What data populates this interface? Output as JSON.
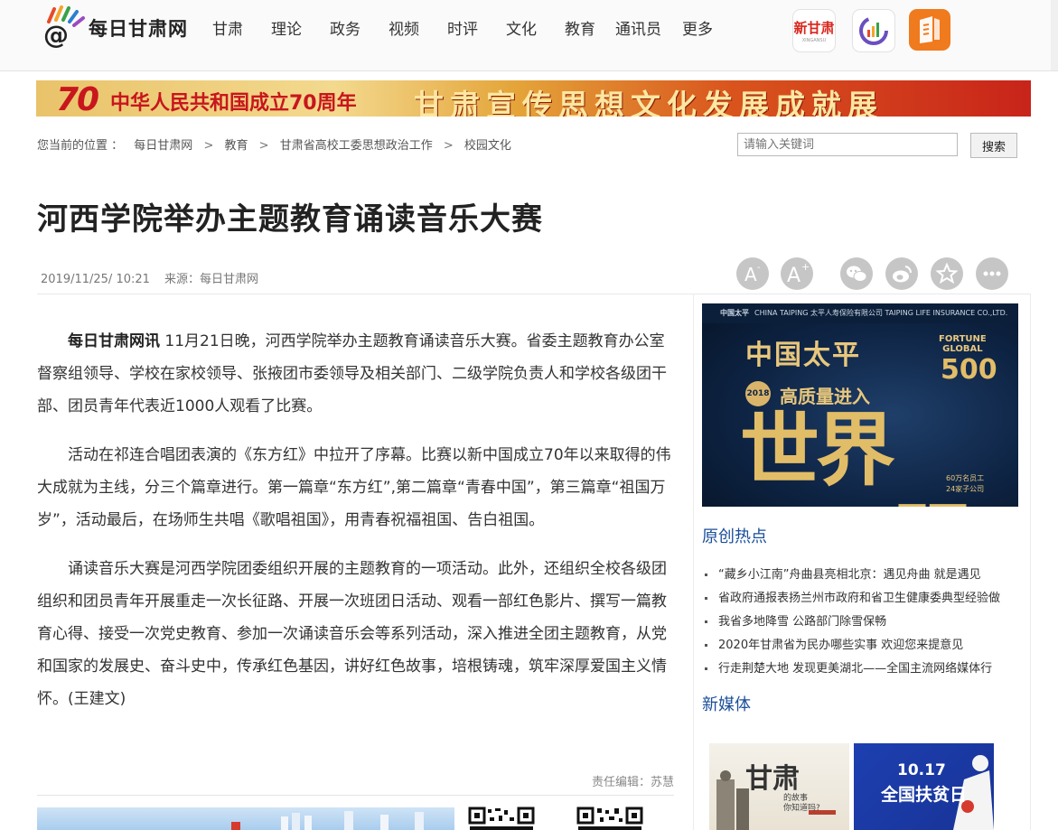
{
  "header": {
    "logo_text": "每日甘肃网",
    "nav": [
      "甘肃",
      "理论",
      "政务",
      "视频",
      "时评",
      "文化",
      "教育",
      "通讯员",
      "更多"
    ],
    "apps": [
      {
        "icon": "xingansu-app-icon",
        "label": "新甘肃",
        "sub": "XINGANSU",
        "color": "#d9251c"
      },
      {
        "icon": "chart-app-icon",
        "color": "#6a4fbf"
      },
      {
        "icon": "book-app-icon",
        "color": "#f07a1e"
      }
    ]
  },
  "banner": {
    "number": "70",
    "left_text": "中华人民共和国成立70周年",
    "right_text": "甘肃宣传思想文化发展成就展"
  },
  "breadcrumb": {
    "prefix": "您当前的位置 ：",
    "items": [
      "每日甘肃网",
      "教育",
      "甘肃省高校工委思想政治工作",
      "校园文化"
    ],
    "separator": ">"
  },
  "search": {
    "placeholder": "请输入关键词",
    "button": "搜索"
  },
  "article": {
    "title": "河西学院举办主题教育诵读音乐大赛",
    "date": "2019/11/25/ 10:21",
    "source": "来源：每日甘肃网",
    "lead": "每日甘肃网讯",
    "p1": " 11月21日晚，河西学院举办主题教育诵读音乐大赛。省委主题教育办公室督察组领导、学校在家校领导、张掖团市委领导及相关部门、二级学院负责人和学校各级团干部、团员青年代表近1000人观看了比赛。",
    "p2": "活动在祁连合唱团表演的《东方红》中拉开了序幕。比赛以新中国成立70年以来取得的伟大成就为主线，分三个篇章进行。第一篇章“东方红”,第二篇章“青春中国”，第三篇章“祖国万岁”，活动最后，在场师生共唱《歌唱祖国》，用青春祝福祖国、告白祖国。",
    "p3": "诵读音乐大赛是河西学院团委组织开展的主题教育的一项活动。此外，还组织全校各级团组织和团员青年开展重走一次长征路、开展一次班团日活动、观看一部红色影片、撰写一篇教育心得、接受一次党史教育、参加一次诵读音乐会等系列活动，深入推进全团主题教育，从党和国家的发展史、奋斗史中，传承红色基因，讲好红色故事，培根铸魂，筑牢深厚爱国主义情怀。(王建文)",
    "editor": "责任编辑：苏慧"
  },
  "tools": [
    "font-smaller-icon",
    "font-larger-icon",
    "wechat-icon",
    "weibo-icon",
    "favorite-icon",
    "more-icon"
  ],
  "ad": {
    "top_cn": "中国太平",
    "top_line": "CHINA TAIPING  太平人寿保险有限公司  TAIPING LIFE INSURANCE CO.,LTD.",
    "brand": "中国太平",
    "year": "2018",
    "mid": "高质量进入",
    "big": "世界500强",
    "fortune": "FORTUNE",
    "global": "GLOBAL",
    "global_num": "500",
    "small1": "60万名员工",
    "small2": "24家子公司"
  },
  "sidebar": {
    "hot_title": "原创热点",
    "hot_items": [
      "“藏乡小江南”舟曲县亮相北京：遇见舟曲 就是遇见",
      "省政府通报表扬兰州市政府和省卫生健康委典型经验做",
      "我省多地降雪 公路部门除雪保畅",
      "2020年甘肃省为民办哪些实事 欢迎您来提意见",
      "行走荆楚大地 发现更美湖北——全国主流网络媒体行"
    ],
    "media_title": "新媒体",
    "media1": {
      "big": "甘肃",
      "sub1": "的故事",
      "sub2": "你知道吗?"
    },
    "media2": {
      "date": "10.17",
      "text": "全国扶贫日"
    }
  }
}
